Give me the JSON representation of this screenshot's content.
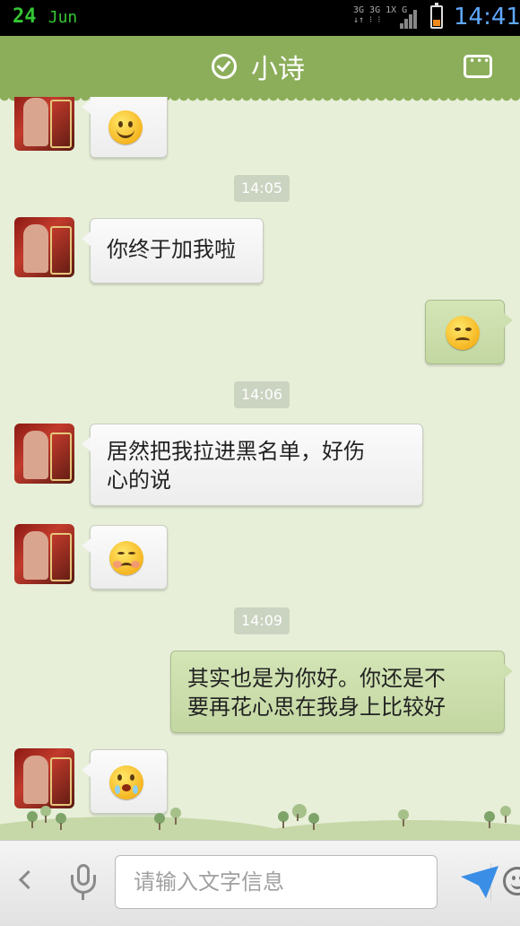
{
  "status_bar": {
    "date_day": "24",
    "date_month": "Jun",
    "network_top": "3G 3G 1X G",
    "time": "14:41",
    "battery_level": 0.3
  },
  "header": {
    "title": "小诗",
    "verified_icon": "check-circle-icon",
    "more_icon": "ellipsis-box-icon"
  },
  "messages": [
    {
      "side": "left",
      "type": "emoji",
      "emoji": "smile"
    },
    {
      "type": "time",
      "text": "14:05"
    },
    {
      "side": "left",
      "type": "text",
      "text": "你终于加我啦"
    },
    {
      "side": "right",
      "type": "emoji",
      "emoji": "worried"
    },
    {
      "type": "time",
      "text": "14:06"
    },
    {
      "side": "left",
      "type": "text",
      "text": "居然把我拉进黑名单，好伤心的说"
    },
    {
      "side": "left",
      "type": "emoji",
      "emoji": "sad"
    },
    {
      "type": "time",
      "text": "14:09"
    },
    {
      "side": "right",
      "type": "text",
      "text": "其实也是为你好。你还是不要再花心思在我身上比较好"
    },
    {
      "side": "left",
      "type": "emoji",
      "emoji": "crying"
    }
  ],
  "text": {
    "msg1": "你终于加我啦",
    "msg2_line1": "居然把我拉进黑名单，好伤",
    "msg2_line2": "心的说",
    "msg3_line1": "其实也是为你好。你还是不",
    "msg3_line2": "要再花心思在我身上比较好",
    "ts1": "14:05",
    "ts2": "14:06",
    "ts3": "14:09"
  },
  "input_bar": {
    "placeholder": "请输入文字信息",
    "icons": [
      "chevron-left-icon",
      "microphone-icon",
      "smiley-icon",
      "send-icon"
    ]
  },
  "colors": {
    "header": "#8cae5a",
    "background": "#e7efd8",
    "right_bubble": "#c9dcaa",
    "send": "#3a8ee6",
    "time_green": "#34c634",
    "time_blue": "#5fa8ff"
  }
}
